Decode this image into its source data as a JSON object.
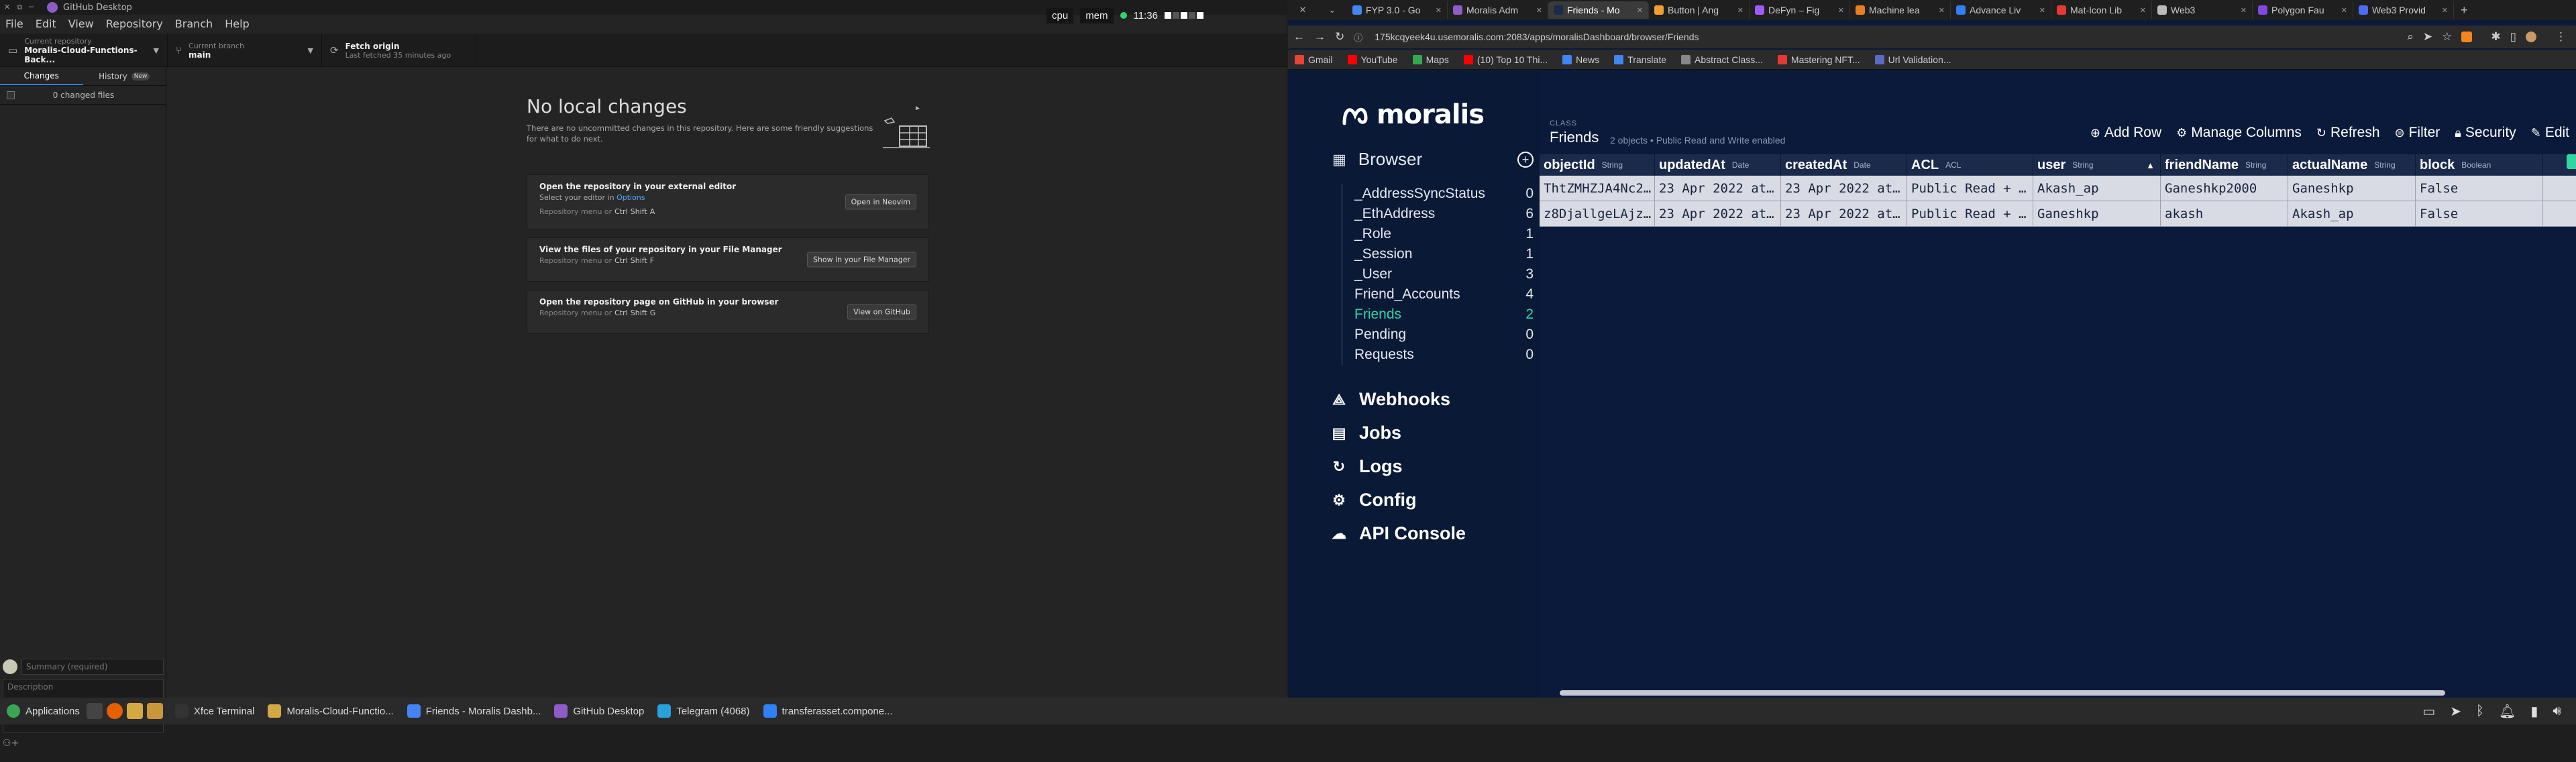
{
  "github": {
    "window_title": "GitHub Desktop",
    "menu": [
      "File",
      "Edit",
      "View",
      "Repository",
      "Branch",
      "Help"
    ],
    "toolbar": {
      "repo_label": "Current repository",
      "repo_value": "Moralis-Cloud-Functions-Back...",
      "branch_label": "Current branch",
      "branch_value": "main",
      "fetch_label": "Fetch origin",
      "fetch_sub": "Last fetched 35 minutes ago"
    },
    "tabs": {
      "changes": "Changes",
      "history": "History",
      "history_badge": "New"
    },
    "changed_files": "0 changed files",
    "summary_placeholder": "Summary (required)",
    "description_placeholder": "Description",
    "main": {
      "title": "No local changes",
      "description": "There are no uncommitted changes in this repository. Here are some friendly suggestions for what to do next.",
      "cards": [
        {
          "title": "Open the repository in your external editor",
          "line2_prefix": "Select your editor in ",
          "line2_link": "Options",
          "kbd_prefix": "Repository menu or",
          "keys": [
            "Ctrl",
            "Shift",
            "A"
          ],
          "button": "Open in Neovim"
        },
        {
          "title": "View the files of your repository in your File Manager",
          "line2_prefix": "",
          "line2_link": "",
          "kbd_prefix": "Repository menu or",
          "keys": [
            "Ctrl",
            "Shift",
            "F"
          ],
          "button": "Show in your File Manager"
        },
        {
          "title": "Open the repository page on GitHub in your browser",
          "line2_prefix": "",
          "line2_link": "",
          "kbd_prefix": "Repository menu or",
          "keys": [
            "Ctrl",
            "Shift",
            "G"
          ],
          "button": "View on GitHub"
        }
      ]
    }
  },
  "panel": {
    "cpu": "cpu",
    "mem": "mem",
    "clock": "11:36"
  },
  "browser": {
    "tabs": [
      {
        "title": "FYP 3.0 - Go",
        "color": "#4285f4"
      },
      {
        "title": "Moralis Adm",
        "color": "#8e5cc7"
      },
      {
        "title": "Friends - Mo",
        "color": "#1b2a4a",
        "active": true
      },
      {
        "title": "Button | Ang",
        "color": "#f0a030"
      },
      {
        "title": "DeFyn – Fig",
        "color": "#a259ff"
      },
      {
        "title": "Machine lea",
        "color": "#e67e22"
      },
      {
        "title": "Advance Liv",
        "color": "#2f81f7"
      },
      {
        "title": "Mat-Icon Lib",
        "color": "#e53935"
      },
      {
        "title": "Web3",
        "color": "#bbbbbb"
      },
      {
        "title": "Polygon Fau",
        "color": "#8247e5"
      },
      {
        "title": "Web3 Provid",
        "color": "#4a6cf7"
      }
    ],
    "url": "175kcqyeek4u.usemoralis.com:2083/apps/moralisDashboard/browser/Friends",
    "bookmarks": [
      {
        "label": "Gmail",
        "color": "#ea4335"
      },
      {
        "label": "YouTube",
        "color": "#ff0000"
      },
      {
        "label": "Maps",
        "color": "#34a853"
      },
      {
        "label": "(10) Top 10 Thi...",
        "color": "#ff0000"
      },
      {
        "label": "News",
        "color": "#4285f4"
      },
      {
        "label": "Translate",
        "color": "#4285f4"
      },
      {
        "label": "Abstract Class...",
        "color": "#888888"
      },
      {
        "label": "Mastering NFT...",
        "color": "#e53935"
      },
      {
        "label": "Url Validation...",
        "color": "#5c6bc0"
      }
    ]
  },
  "moralis": {
    "logo": "moralis",
    "browser_label": "Browser",
    "classes": [
      {
        "name": "_AddressSyncStatus",
        "count": "0"
      },
      {
        "name": "_EthAddress",
        "count": "6"
      },
      {
        "name": "_Role",
        "count": "1"
      },
      {
        "name": "_Session",
        "count": "1"
      },
      {
        "name": "_User",
        "count": "3"
      },
      {
        "name": "Friend_Accounts",
        "count": "4"
      },
      {
        "name": "Friends",
        "count": "2",
        "active": true
      },
      {
        "name": "Pending",
        "count": "0"
      },
      {
        "name": "Requests",
        "count": "0"
      }
    ],
    "nav": [
      "Webhooks",
      "Jobs",
      "Logs",
      "Config",
      "API Console"
    ],
    "class_label": "CLASS",
    "class_name": "Friends",
    "class_meta": "2 objects • Public Read and Write enabled",
    "actions": [
      "Add Row",
      "Manage Columns",
      "Refresh",
      "Filter",
      "Security",
      "Edit"
    ],
    "columns": [
      {
        "name": "objectId",
        "type": "String"
      },
      {
        "name": "updatedAt",
        "type": "Date"
      },
      {
        "name": "createdAt",
        "type": "Date"
      },
      {
        "name": "ACL",
        "type": "ACL"
      },
      {
        "name": "user",
        "type": "String"
      },
      {
        "name": "friendName",
        "type": "String"
      },
      {
        "name": "actualName",
        "type": "String"
      },
      {
        "name": "block",
        "type": "Boolean"
      }
    ],
    "rows": [
      [
        "ThtZMHZJA4Nc2…",
        "23 Apr 2022 at…",
        "23 Apr 2022 at…",
        "Public Read + …",
        "Akash_ap",
        "Ganeshkp2000",
        "Ganeshkp",
        "False"
      ],
      [
        "z8DjallgeLAjz…",
        "23 Apr 2022 at…",
        "23 Apr 2022 at…",
        "Public Read + …",
        "Ganeshkp",
        "akash",
        "Akash_ap",
        "False"
      ]
    ]
  },
  "taskbar": {
    "items": [
      {
        "label": "Applications",
        "color": "#3aa655"
      },
      {
        "label": "Xfce Terminal",
        "color": "#333333"
      },
      {
        "label": "Moralis-Cloud-Functio...",
        "color": "#d4a843"
      },
      {
        "label": "Friends - Moralis Dashb...",
        "color": "#4285f4"
      },
      {
        "label": "GitHub Desktop",
        "color": "#8e5cc7"
      },
      {
        "label": "Telegram (4068)",
        "color": "#2aa1da"
      },
      {
        "label": "transferasset.compone...",
        "color": "#2f81f7"
      }
    ]
  }
}
